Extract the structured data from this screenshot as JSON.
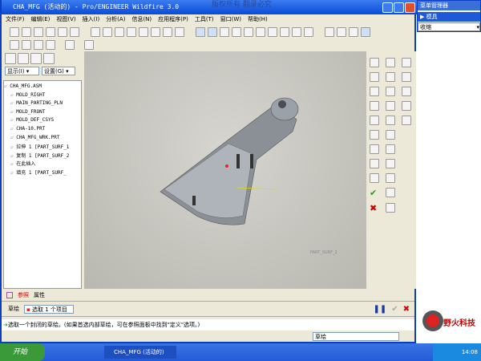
{
  "window": {
    "title": "CHA_MFG (活动的) - Pro/ENGINEER Wildfire 3.0",
    "watermark": "版权所有 翻录必究"
  },
  "menu": [
    "文件(F)",
    "编辑(E)",
    "视图(V)",
    "插入(I)",
    "分析(A)",
    "信息(N)",
    "应用程序(P)",
    "工具(T)",
    "窗口(W)",
    "帮助(H)"
  ],
  "left_panel": {
    "show_label": "显示(I) ▾",
    "settings_label": "设置(G) ▾",
    "tree": [
      {
        "label": "CHA_MFG.ASM",
        "indent": 0,
        "icon": "assembly-icon"
      },
      {
        "label": "MOLD_RIGHT",
        "indent": 1,
        "icon": "datum-plane-icon"
      },
      {
        "label": "MAIN_PARTING_PLN",
        "indent": 1,
        "icon": "datum-plane-icon"
      },
      {
        "label": "MOLD_FRONT",
        "indent": 1,
        "icon": "datum-plane-icon"
      },
      {
        "label": "MOLD_DEF_CSYS",
        "indent": 1,
        "icon": "csys-icon"
      },
      {
        "label": "CHA-10.PRT",
        "indent": 1,
        "icon": "part-icon"
      },
      {
        "label": "CHA_MFG_WRK.PRT",
        "indent": 1,
        "icon": "workpiece-icon"
      },
      {
        "label": "拉伸 1 [PART_SURF_1",
        "indent": 1,
        "icon": "surface-icon"
      },
      {
        "label": "复制 1 [PART_SURF_2",
        "indent": 1,
        "icon": "surface-icon"
      },
      {
        "label": "在此插入",
        "indent": 1,
        "icon": "insert-here-icon"
      },
      {
        "label": "填充 1 [PART_SURF_",
        "indent": 1,
        "icon": "surface-icon"
      }
    ]
  },
  "viewport": {
    "label": "PART_SURF_2"
  },
  "dashboard": {
    "tabs": [
      "参照",
      "属性"
    ],
    "field_label": "草绘",
    "collector": "选取 1 个项目"
  },
  "message": "选取一个封闭的草绘。(如果首选内部草绘，可在参照面板中找到\"定义\"选项。)",
  "filter": "草绘",
  "menu_manager": {
    "title": "菜单管理器",
    "item": "模具",
    "dropdown": "收缩"
  },
  "logo": {
    "text": "野火科技"
  },
  "taskbar": {
    "start": "开始",
    "task": "CHA_MFG (活动的)",
    "time": "14:08"
  }
}
